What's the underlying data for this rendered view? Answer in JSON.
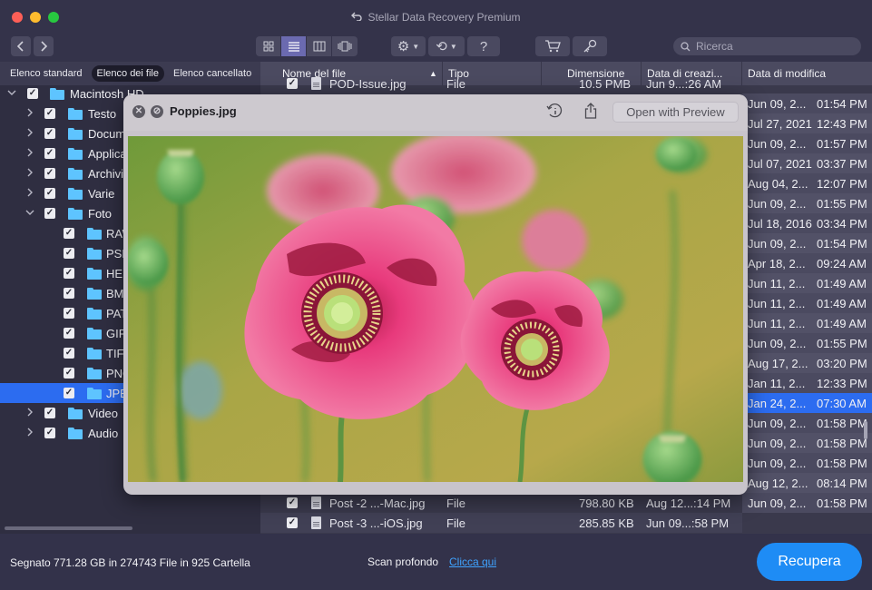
{
  "window": {
    "title": "Stellar Data Recovery Premium"
  },
  "toolbar": {
    "nav_back_icon": "chevron-left-icon",
    "nav_forward_icon": "chevron-right-icon",
    "view_modes": [
      "grid-view-icon",
      "list-view-icon",
      "column-view-icon",
      "cover-flow-icon"
    ],
    "active_view": "list-view-icon",
    "settings_icon": "gear-icon",
    "history_icon": "history-icon",
    "help_label": "?",
    "cart_icon": "cart-icon",
    "key_icon": "key-icon",
    "search_placeholder": "Ricerca"
  },
  "left_tabs": [
    "Elenco standard",
    "Elenco dei file",
    "Elenco cancellato"
  ],
  "active_left_tab": "Elenco dei file",
  "tree": [
    {
      "label": "Macintosh HD",
      "level": 0,
      "expanded": true,
      "checked": true
    },
    {
      "label": "Testo",
      "level": 1,
      "expanded": false,
      "checked": true
    },
    {
      "label": "Documenti",
      "level": 1,
      "expanded": false,
      "checked": true
    },
    {
      "label": "Applicazioni",
      "level": 1,
      "expanded": false,
      "checked": true
    },
    {
      "label": "Archivio",
      "level": 1,
      "expanded": false,
      "checked": true
    },
    {
      "label": "Varie",
      "level": 1,
      "expanded": false,
      "checked": true
    },
    {
      "label": "Foto",
      "level": 1,
      "expanded": true,
      "checked": true
    },
    {
      "label": "RAW",
      "level": 2,
      "checked": true
    },
    {
      "label": "PSD",
      "level": 2,
      "checked": true
    },
    {
      "label": "HEIC",
      "level": 2,
      "checked": true
    },
    {
      "label": "BMP",
      "level": 2,
      "checked": true
    },
    {
      "label": "PAT",
      "level": 2,
      "checked": true
    },
    {
      "label": "GIF",
      "level": 2,
      "checked": true
    },
    {
      "label": "TIFF",
      "level": 2,
      "checked": true
    },
    {
      "label": "PNG",
      "level": 2,
      "checked": true
    },
    {
      "label": "JPEG",
      "level": 2,
      "checked": true,
      "selected": true
    },
    {
      "label": "Video",
      "level": 1,
      "expanded": false,
      "checked": true
    },
    {
      "label": "Audio",
      "level": 1,
      "expanded": false,
      "checked": true
    }
  ],
  "table": {
    "columns": [
      "Nome del file",
      "Tipo",
      "Dimensione",
      "Data di creazi...",
      "Data di modifica"
    ],
    "sort_indicator": "▲",
    "modified_dates": [
      {
        "date": "Jun 09, 2...",
        "time": "01:54 PM"
      },
      {
        "date": "Jul 27, 2021",
        "time": "12:43 PM"
      },
      {
        "date": "Jun 09, 2...",
        "time": "01:57 PM"
      },
      {
        "date": "Jul 07, 2021",
        "time": "03:37 PM"
      },
      {
        "date": "Aug 04, 2...",
        "time": "12:07 PM"
      },
      {
        "date": "Jun 09, 2...",
        "time": "01:55 PM"
      },
      {
        "date": "Jul 18, 2016",
        "time": "03:34 PM"
      },
      {
        "date": "Jun 09, 2...",
        "time": "01:54 PM"
      },
      {
        "date": "Apr 18, 2...",
        "time": "09:24 AM"
      },
      {
        "date": "Jun 11, 2...",
        "time": "01:49 AM"
      },
      {
        "date": "Jun 11, 2...",
        "time": "01:49 AM"
      },
      {
        "date": "Jun 11, 2...",
        "time": "01:49 AM"
      },
      {
        "date": "Jun 09, 2...",
        "time": "01:55 PM"
      },
      {
        "date": "Aug 17, 2...",
        "time": "03:20 PM"
      },
      {
        "date": "Jan 11, 2...",
        "time": "12:33 PM"
      },
      {
        "date": "Jan 24, 2...",
        "time": "07:30 AM",
        "selected": true
      },
      {
        "date": "Jun 09, 2...",
        "time": "01:58 PM"
      },
      {
        "date": "Jun 09, 2...",
        "time": "01:58 PM"
      },
      {
        "date": "Jun 09, 2...",
        "time": "01:58 PM"
      },
      {
        "date": "Aug 12, 2...",
        "time": "08:14 PM"
      },
      {
        "date": "Jun 09, 2...",
        "time": "01:58 PM"
      }
    ],
    "visible_rows": [
      {
        "name": "Post -2 ...-Mac.jpg",
        "type": "File",
        "size": "798.80 KB",
        "created": "Aug 12...:14 PM"
      },
      {
        "name": "Post -3 ...-iOS.jpg",
        "type": "File",
        "size": "285.85 KB",
        "created": "Jun 09...:58 PM"
      }
    ],
    "partial_top_row": {
      "name": "POD-Issue.jpg",
      "type": "File",
      "size": "10.5 PMB",
      "created": "Jun 9...:26 AM"
    }
  },
  "preview": {
    "filename": "Poppies.jpg",
    "close_icon": "close-icon",
    "minimize_icon": "minimize-icon",
    "info_icon": "info-rotate-icon",
    "share_icon": "share-icon",
    "open_button": "Open with Preview"
  },
  "status": {
    "summary": "Segnato 771.28 GB in 274743 File in 925 Cartella",
    "deep_scan_label": "Scan profondo",
    "deep_scan_link": "Clicca qui",
    "recover_button": "Recupera"
  },
  "colors": {
    "accent": "#2c6cf0",
    "recover_button": "#1e8cf5",
    "folder": "#5ec4ff",
    "link": "#3fa3ff"
  }
}
